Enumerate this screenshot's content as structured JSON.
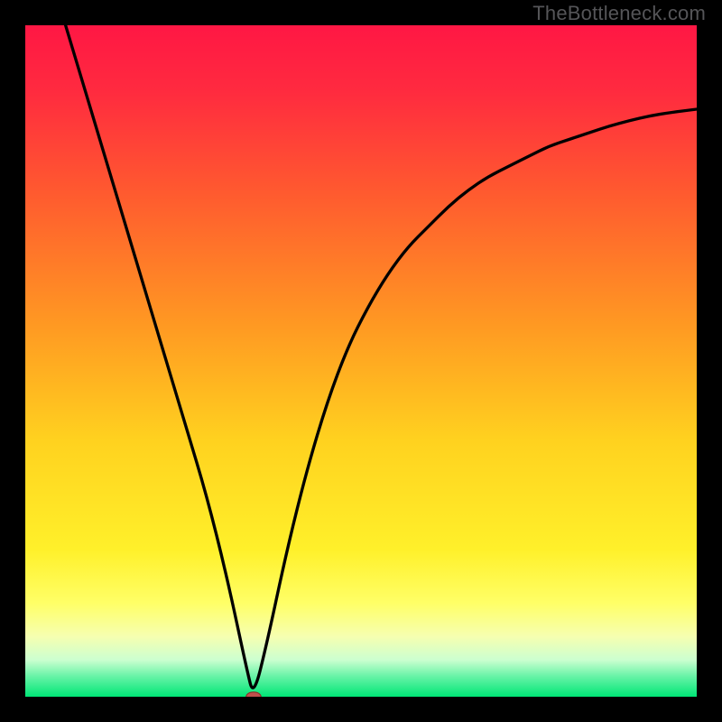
{
  "watermark": "TheBottleneck.com",
  "colors": {
    "frame": "#000000",
    "gradient_stops": [
      {
        "offset": 0.0,
        "color": "#ff1744"
      },
      {
        "offset": 0.1,
        "color": "#ff2b3f"
      },
      {
        "offset": 0.25,
        "color": "#ff5a2f"
      },
      {
        "offset": 0.45,
        "color": "#ff9a22"
      },
      {
        "offset": 0.62,
        "color": "#ffd21f"
      },
      {
        "offset": 0.78,
        "color": "#fff02a"
      },
      {
        "offset": 0.86,
        "color": "#ffff66"
      },
      {
        "offset": 0.91,
        "color": "#f6ffb0"
      },
      {
        "offset": 0.945,
        "color": "#ccffd0"
      },
      {
        "offset": 0.97,
        "color": "#66f3a6"
      },
      {
        "offset": 1.0,
        "color": "#00e676"
      }
    ],
    "curve": "#000000",
    "marker_fill": "#c0504d",
    "marker_stroke": "#8a2f2b"
  },
  "chart_data": {
    "type": "line",
    "title": "",
    "xlabel": "",
    "ylabel": "",
    "xlim": [
      0,
      100
    ],
    "ylim": [
      0,
      100
    ],
    "grid": false,
    "series": [
      {
        "name": "bottleneck-curve",
        "x": [
          0,
          3,
          6,
          9,
          12,
          15,
          18,
          21,
          24,
          27,
          30,
          33,
          34,
          36,
          39,
          42,
          45,
          48,
          51,
          54,
          57,
          60,
          63,
          66,
          69,
          72,
          75,
          78,
          81,
          84,
          87,
          90,
          93,
          96,
          100
        ],
        "y": [
          130,
          110,
          100,
          90,
          80,
          70,
          60,
          50,
          40,
          30,
          18,
          4,
          0,
          8,
          22,
          34,
          44,
          52,
          58,
          63,
          67,
          70,
          73,
          75.5,
          77.5,
          79,
          80.5,
          82,
          83,
          84,
          85,
          85.8,
          86.5,
          87,
          87.5
        ]
      }
    ],
    "marker": {
      "x": 34,
      "y": 0,
      "rx": 1.1,
      "ry": 0.7
    }
  }
}
